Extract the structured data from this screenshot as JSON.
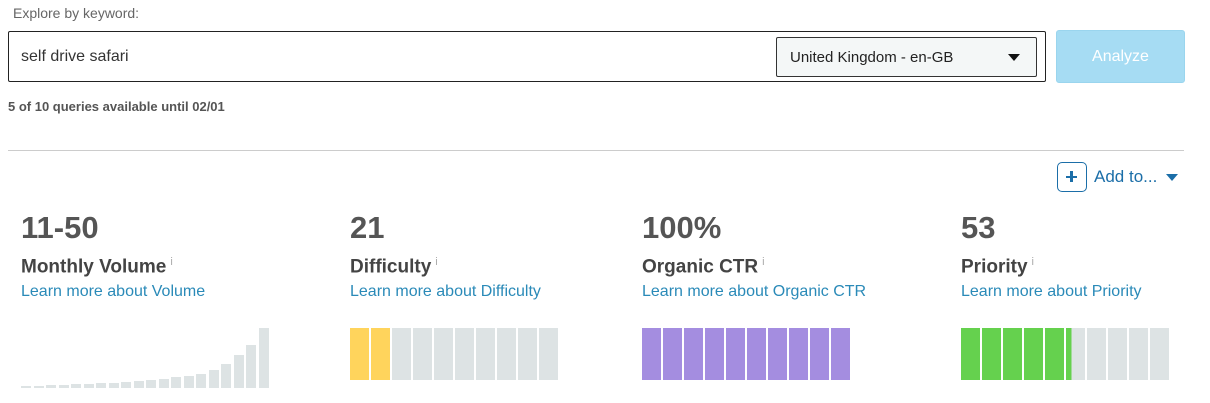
{
  "search": {
    "label": "Explore by keyword:",
    "value": "self drive safari",
    "locale": "United Kingdom - en-GB",
    "analyze_label": "Analyze"
  },
  "quota_text": "5 of 10 queries available until 02/01",
  "add_to": {
    "label": "Add to..."
  },
  "metrics": [
    {
      "value": "11-50",
      "name": "Monthly Volume",
      "link": "Learn more about Volume"
    },
    {
      "value": "21",
      "name": "Difficulty",
      "link": "Learn more about Difficulty",
      "filled_segments": 2,
      "total_segments": 10,
      "fill_color": "#ffd45c"
    },
    {
      "value": "100%",
      "name": "Organic CTR",
      "link": "Learn more about Organic CTR",
      "filled_segments": 10,
      "total_segments": 10,
      "fill_color": "#a48de0"
    },
    {
      "value": "53",
      "name": "Priority",
      "link": "Learn more about Priority",
      "filled_segments": 5.3,
      "total_segments": 10,
      "fill_color": "#65d14e"
    }
  ],
  "volume_chart": {
    "bar_count": 20,
    "levels": [
      0.04,
      0.04,
      0.05,
      0.05,
      0.06,
      0.07,
      0.08,
      0.09,
      0.1,
      0.11,
      0.13,
      0.15,
      0.18,
      0.2,
      0.24,
      0.3,
      0.4,
      0.55,
      0.72,
      1.0
    ]
  },
  "colors": {
    "accent": "#1b6ea8",
    "link": "#2a8ab8",
    "bar_empty": "#dde3e4",
    "analyze_bg": "#a6dcf3"
  }
}
